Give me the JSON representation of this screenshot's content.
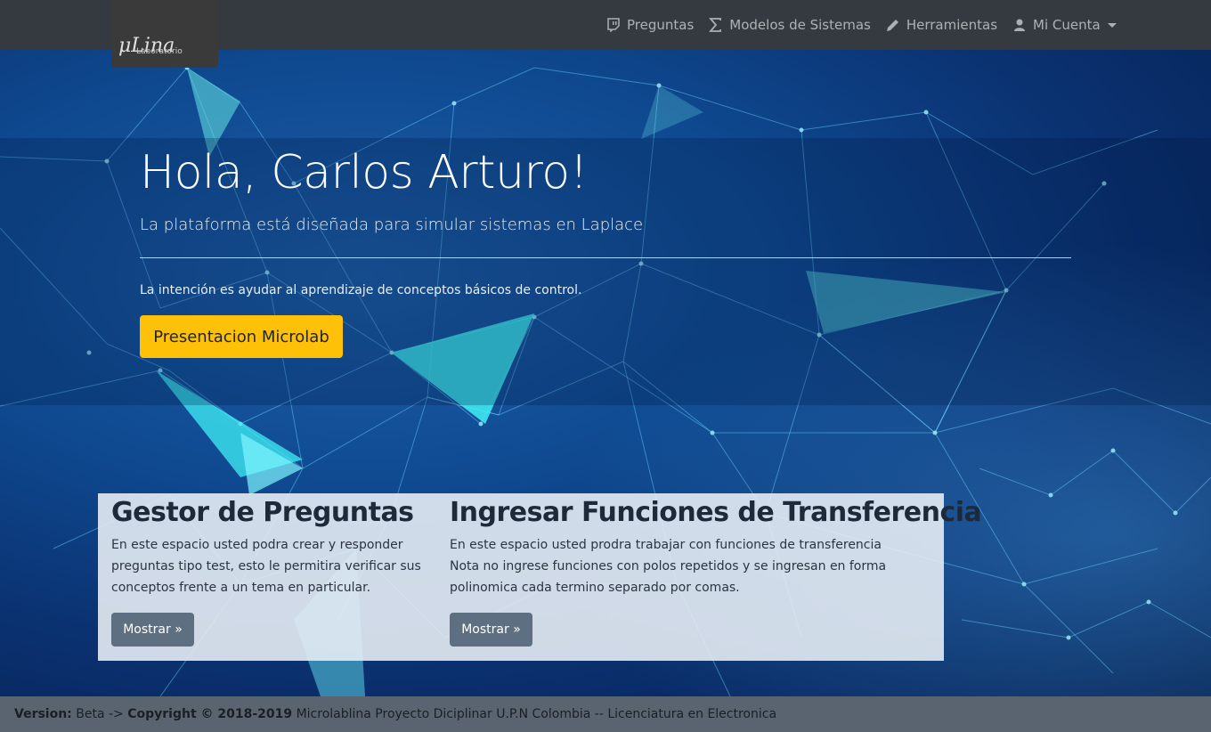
{
  "brand": {
    "logo_main": "μLina",
    "logo_sub": "Laboratorio"
  },
  "nav": {
    "items": [
      {
        "label": "Preguntas",
        "icon": "twitch-icon"
      },
      {
        "label": "Modelos de Sistemas",
        "icon": "sigma-icon"
      },
      {
        "label": "Herramientas",
        "icon": "pencil-icon"
      },
      {
        "label": "Mi Cuenta",
        "icon": "user-icon"
      }
    ]
  },
  "jumbotron": {
    "greeting": "Hola, Carlos Arturo!",
    "lead": "La plataforma está diseñada para simular sistemas en Laplace",
    "text": "La intención es ayudar al aprendizaje de conceptos básicos de control.",
    "button_label": "Presentacion Microlab"
  },
  "cards": [
    {
      "title": "Gestor de Preguntas",
      "lines": [
        "En este espacio usted podra crear y responder",
        "preguntas tipo test, esto le permitira verificar sus",
        "conceptos frente a un tema en particular."
      ],
      "button_label": "Mostrar »"
    },
    {
      "title": "Ingresar Funciones de Transferencia",
      "lines": [
        "En este espacio usted prodra trabajar con funciones de transferencia",
        "Nota no ingrese funciones con polos repetidos y se ingresan en forma",
        "polinomica cada termino separado por comas."
      ],
      "button_label": "Mostrar »"
    }
  ],
  "footer": {
    "version_label": "Version:",
    "version_value": " Beta -> ",
    "copyright_label": "Copyright © 2018-2019",
    "copyright_text": " Microlablina Proyecto Diciplinar U.P.N Colombia -- Licenciatura en Electronica"
  },
  "colors": {
    "navbar": "#343a40",
    "accent_button": "#ffc107",
    "secondary_button": "#5d6f81",
    "footer": "#5a6470"
  }
}
